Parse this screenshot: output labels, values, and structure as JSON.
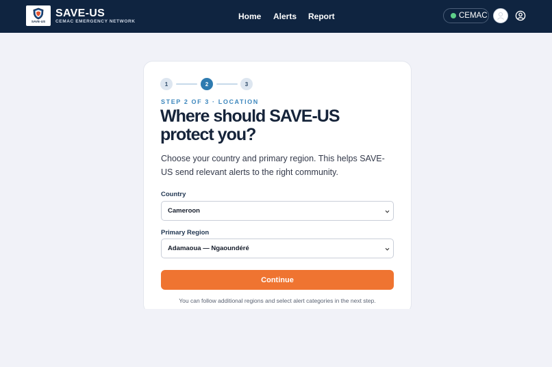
{
  "header": {
    "logo_text": "SAVE-US",
    "brand_title": "SAVE-US",
    "brand_subtitle": "CEMAC EMERGENCY NETWORK",
    "nav": {
      "home": "Home",
      "alerts": "Alerts",
      "report": "Report"
    },
    "region_pill": "CEMAC",
    "region_status_color": "#5ed08a",
    "icons": [
      "shield-logo-icon",
      "user-avatar-icon",
      "account-icon"
    ]
  },
  "stepper": {
    "steps": [
      "1",
      "2",
      "3"
    ],
    "current": 2
  },
  "form": {
    "eyebrow": "STEP 2 OF 3 · LOCATION",
    "headline": "Where should SAVE-US protect you?",
    "intro": "Choose your country and primary region. This helps SAVE-US send relevant alerts to the right community.",
    "country_label": "Country",
    "country_value": "Cameroon",
    "region_label": "Primary Region",
    "region_value": "Adamaoua — Ngaoundéré",
    "continue_label": "Continue",
    "footnote": "You can follow additional regions and select alert categories in the next step."
  },
  "colors": {
    "header_bg": "#0f2440",
    "accent_blue": "#2e7bb0",
    "cta_orange": "#ef7431",
    "page_bg": "#f1f2f8"
  }
}
